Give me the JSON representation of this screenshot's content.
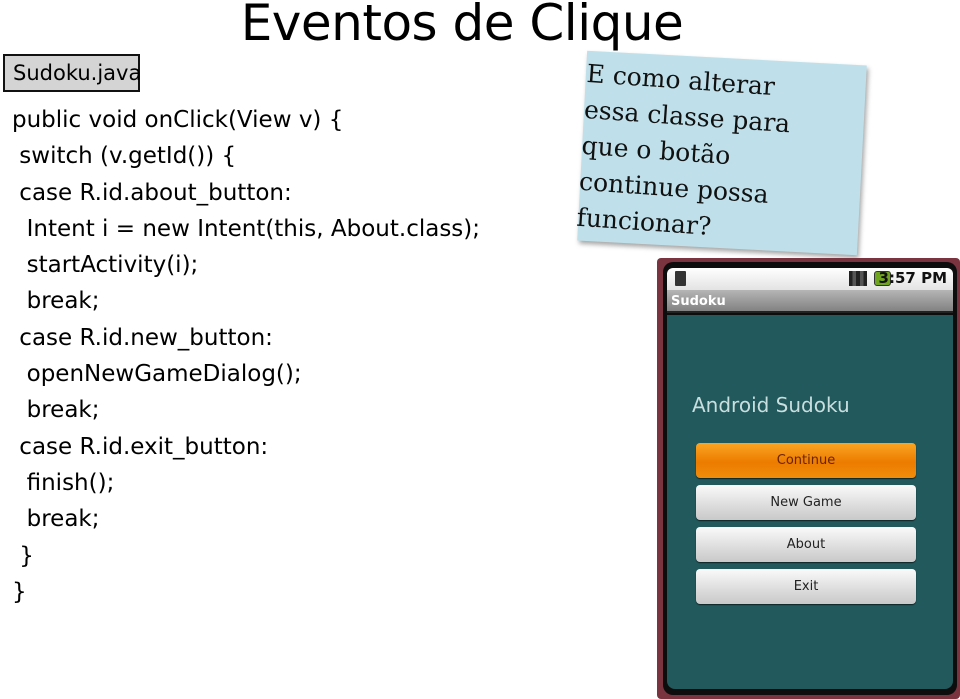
{
  "slide": {
    "title": "Eventos de Clique",
    "file_tab": "Sudoku.java",
    "code_lines": [
      "public void onClick(View v) {",
      " switch (v.getId()) {",
      " case R.id.about_button:",
      "  Intent i = new Intent(this, About.class);",
      "  startActivity(i);",
      "  break;",
      " case R.id.new_button:",
      "  openNewGameDialog();",
      "  break;",
      " case R.id.exit_button:",
      "  finish();",
      "  break;",
      " }",
      "}"
    ],
    "note_lines": [
      "E como alterar",
      "essa classe para",
      "que o botão",
      "continue possa",
      "funcionar?"
    ]
  },
  "phone": {
    "status_bar": {
      "sim_icon": "sim-card-icon",
      "signal_icon": "signal-icon",
      "battery_icon": "battery-charging-icon",
      "time": "3:57 PM"
    },
    "app_bar_title": "Sudoku",
    "heading": "Android Sudoku",
    "buttons": [
      {
        "label": "Continue",
        "style": "primary"
      },
      {
        "label": "New Game",
        "style": "normal"
      },
      {
        "label": "About",
        "style": "normal"
      },
      {
        "label": "Exit",
        "style": "normal"
      }
    ],
    "colors": {
      "background": "#22595c",
      "primary_button": "#f08c0a",
      "frame": "#7a3440"
    }
  }
}
